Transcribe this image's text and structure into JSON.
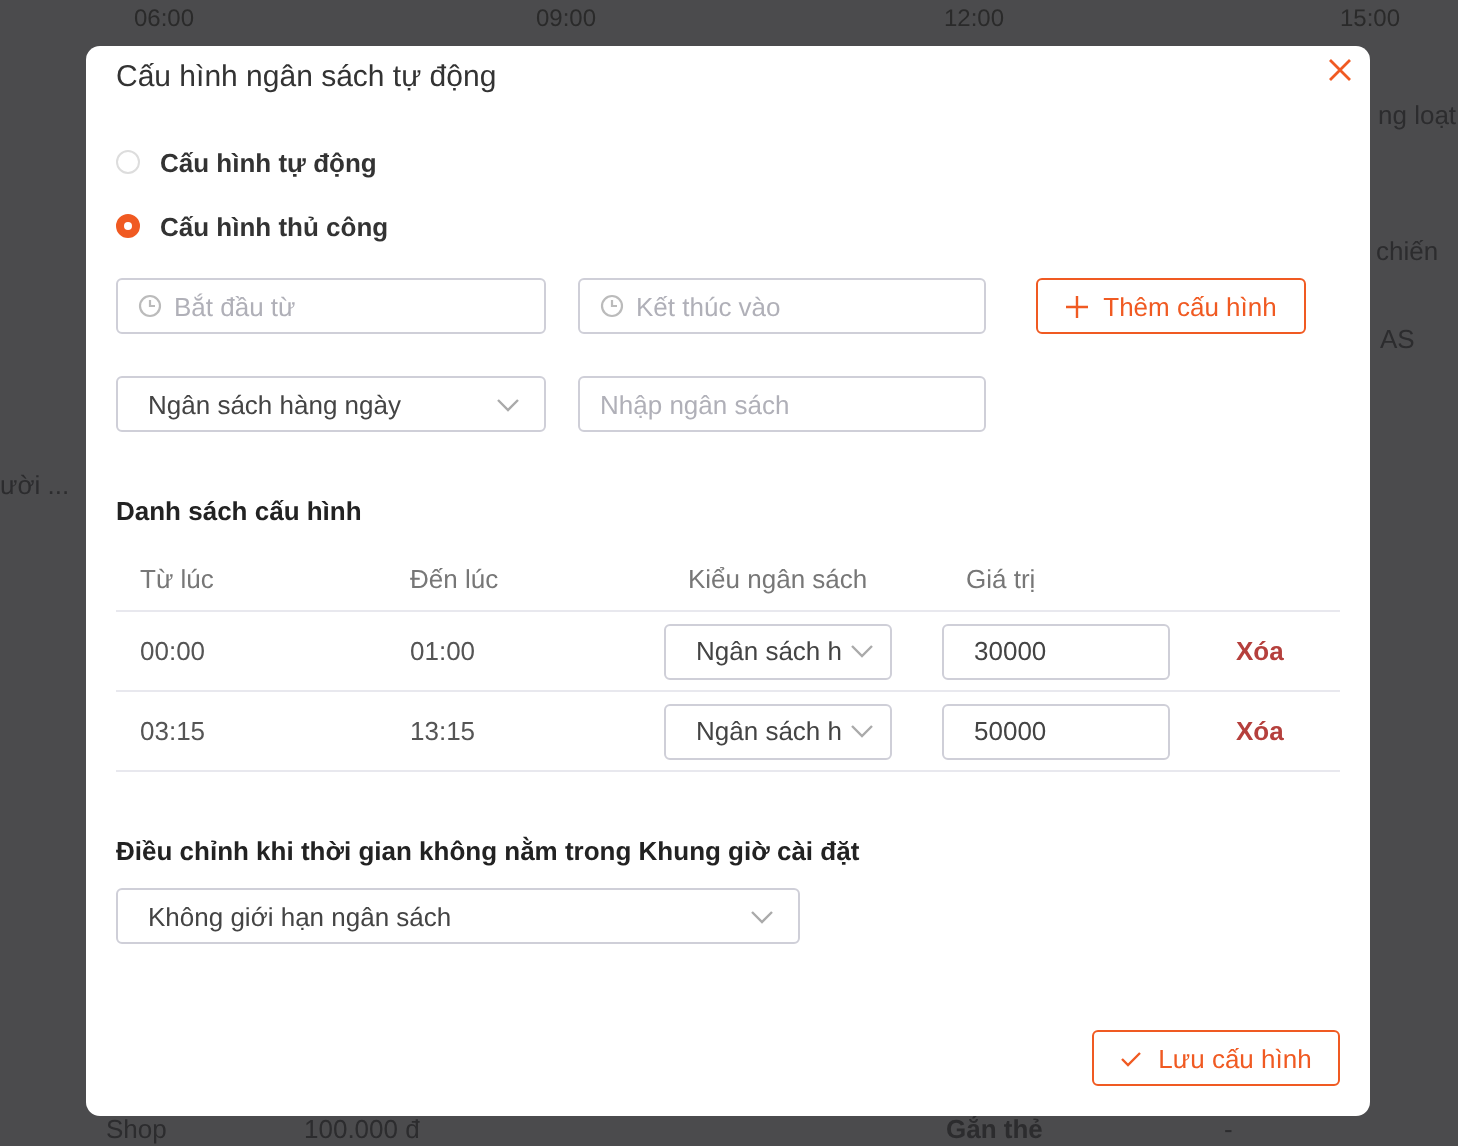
{
  "background": {
    "time_axis": [
      "06:00",
      "09:00",
      "12:00",
      "15:00"
    ],
    "right_fragments": [
      "ng loạt",
      "chiến",
      "AS"
    ],
    "left_fragment": "ười ...",
    "bottom_row": [
      "Shop",
      "100.000 đ",
      "Gắn thẻ",
      "-"
    ]
  },
  "dialog": {
    "title": "Cấu hình ngân sách tự động",
    "modes": [
      {
        "label": "Cấu hình tự động",
        "selected": false
      },
      {
        "label": "Cấu hình thủ công",
        "selected": true
      }
    ],
    "start_field": {
      "placeholder": "Bắt đầu từ"
    },
    "end_field": {
      "placeholder": "Kết thúc vào"
    },
    "add_button": "Thêm cấu hình",
    "budget_type": {
      "value": "Ngân sách hàng ngày"
    },
    "budget_input": {
      "placeholder": "Nhập ngân sách"
    },
    "list_title": "Danh sách cấu hình",
    "table": {
      "columns": [
        "Từ lúc",
        "Đến lúc",
        "Kiểu ngân sách",
        "Giá trị"
      ],
      "rows": [
        {
          "from": "00:00",
          "to": "01:00",
          "type": "Ngân sách h",
          "value": "30000",
          "action": "Xóa"
        },
        {
          "from": "03:15",
          "to": "13:15",
          "type": "Ngân sách h",
          "value": "50000",
          "action": "Xóa"
        }
      ]
    },
    "fallback_title": "Điều chỉnh khi thời gian không nằm trong Khung giờ cài đặt",
    "fallback_select": {
      "value": "Không giới hạn ngân sách"
    },
    "save_button": "Lưu cấu hình"
  }
}
